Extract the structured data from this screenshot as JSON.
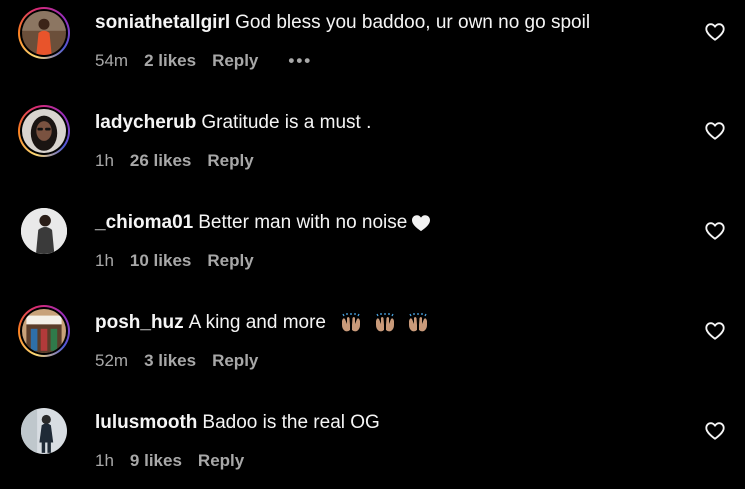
{
  "comments": [
    {
      "username": "soniathetallgirl",
      "text": "God bless you baddoo, ur own no go spoil",
      "time": "54m",
      "likes": "2 likes",
      "reply": "Reply",
      "more": "•••",
      "has_story_ring": true
    },
    {
      "username": "ladycherub",
      "text": "Gratitude is a must .",
      "time": "1h",
      "likes": "26 likes",
      "reply": "Reply",
      "has_story_ring": true
    },
    {
      "username": "_chioma01",
      "text": "Better man with no noise",
      "emoji": "white-heart-icon",
      "time": "1h",
      "likes": "10 likes",
      "reply": "Reply",
      "has_story_ring": false
    },
    {
      "username": "posh_huz",
      "text": "A king and more",
      "emoji": "raising-hands-icon x3",
      "time": "52m",
      "likes": "3 likes",
      "reply": "Reply",
      "has_story_ring": true
    },
    {
      "username": "lulusmooth",
      "text": "Badoo is the real OG",
      "time": "1h",
      "likes": "9 likes",
      "reply": "Reply",
      "has_story_ring": false
    }
  ],
  "colors": {
    "background": "#000000",
    "primary_text": "#f5f5f5",
    "secondary_text": "#a8a8a8"
  }
}
